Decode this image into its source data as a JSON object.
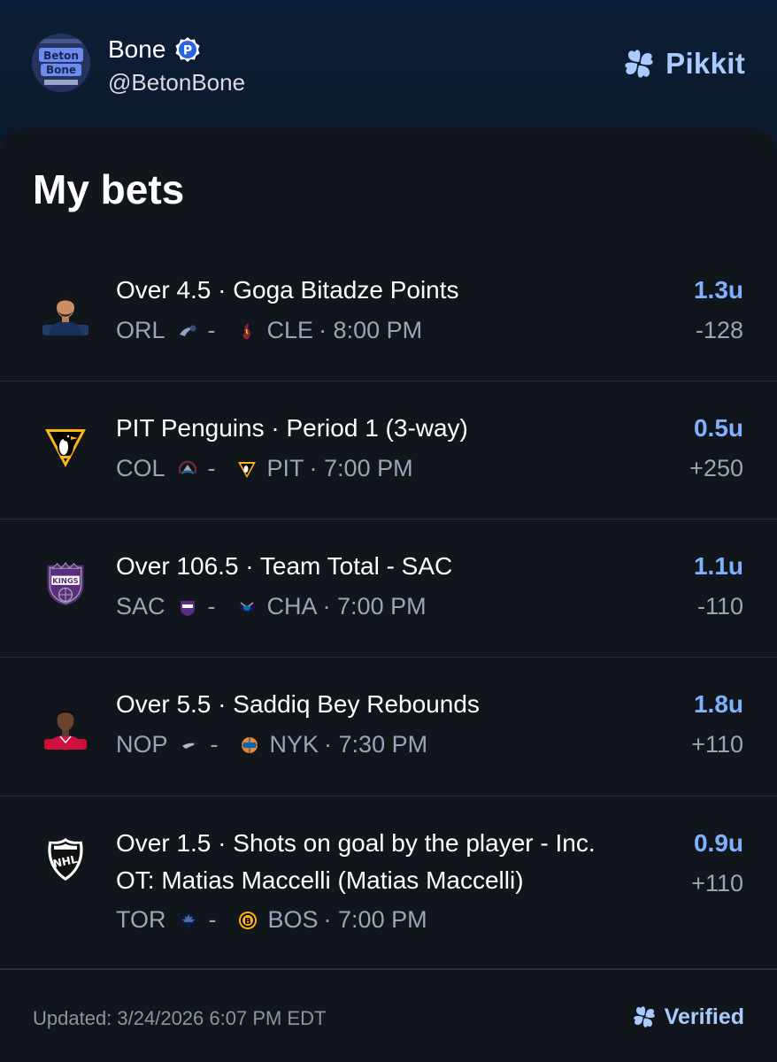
{
  "profile": {
    "name": "Bone",
    "badge_letter": "P",
    "handle": "@BetonBone",
    "avatar_text": "Beton Bone"
  },
  "brand": {
    "name": "Pikkit"
  },
  "page_title": "My bets",
  "bets": [
    {
      "selection": "Over 4.5 · Goga Bitadze Points",
      "selection_line2": "",
      "home": "ORL",
      "away": "CLE",
      "time": "· 8:00 PM",
      "units": "1.3u",
      "odds": "-128",
      "logo_icon": "player-headshot-icon"
    },
    {
      "selection": "PIT Penguins · Period 1 (3-way)",
      "selection_line2": "",
      "home": "COL",
      "away": "PIT",
      "time": "· 7:00 PM",
      "units": "0.5u",
      "odds": "+250",
      "logo_icon": "penguins-logo-icon"
    },
    {
      "selection": "Over 106.5 · Team Total - SAC",
      "selection_line2": "",
      "home": "SAC",
      "away": "CHA",
      "time": "· 7:00 PM",
      "units": "1.1u",
      "odds": "-110",
      "logo_icon": "kings-logo-icon"
    },
    {
      "selection": "Over 5.5 · Saddiq Bey Rebounds",
      "selection_line2": "",
      "home": "NOP",
      "away": "NYK",
      "time": "· 7:30 PM",
      "units": "1.8u",
      "odds": "+110",
      "logo_icon": "player-headshot-icon"
    },
    {
      "selection": "Over 1.5 · Shots on goal by the player - Inc.",
      "selection_line2": "OT: Matias Maccelli (Matias Maccelli)",
      "home": "TOR",
      "away": "BOS",
      "time": "· 7:00 PM",
      "units": "0.9u",
      "odds": "+110",
      "logo_icon": "nhl-logo-icon"
    }
  ],
  "footer": {
    "updated": "Updated: 3/24/2026 6:07 PM EDT",
    "verified": "Verified"
  },
  "colors": {
    "accent": "#7fb1ff",
    "brand": "#a9cbff",
    "card_bg": "#11151c",
    "muted": "#9aa6b8"
  }
}
